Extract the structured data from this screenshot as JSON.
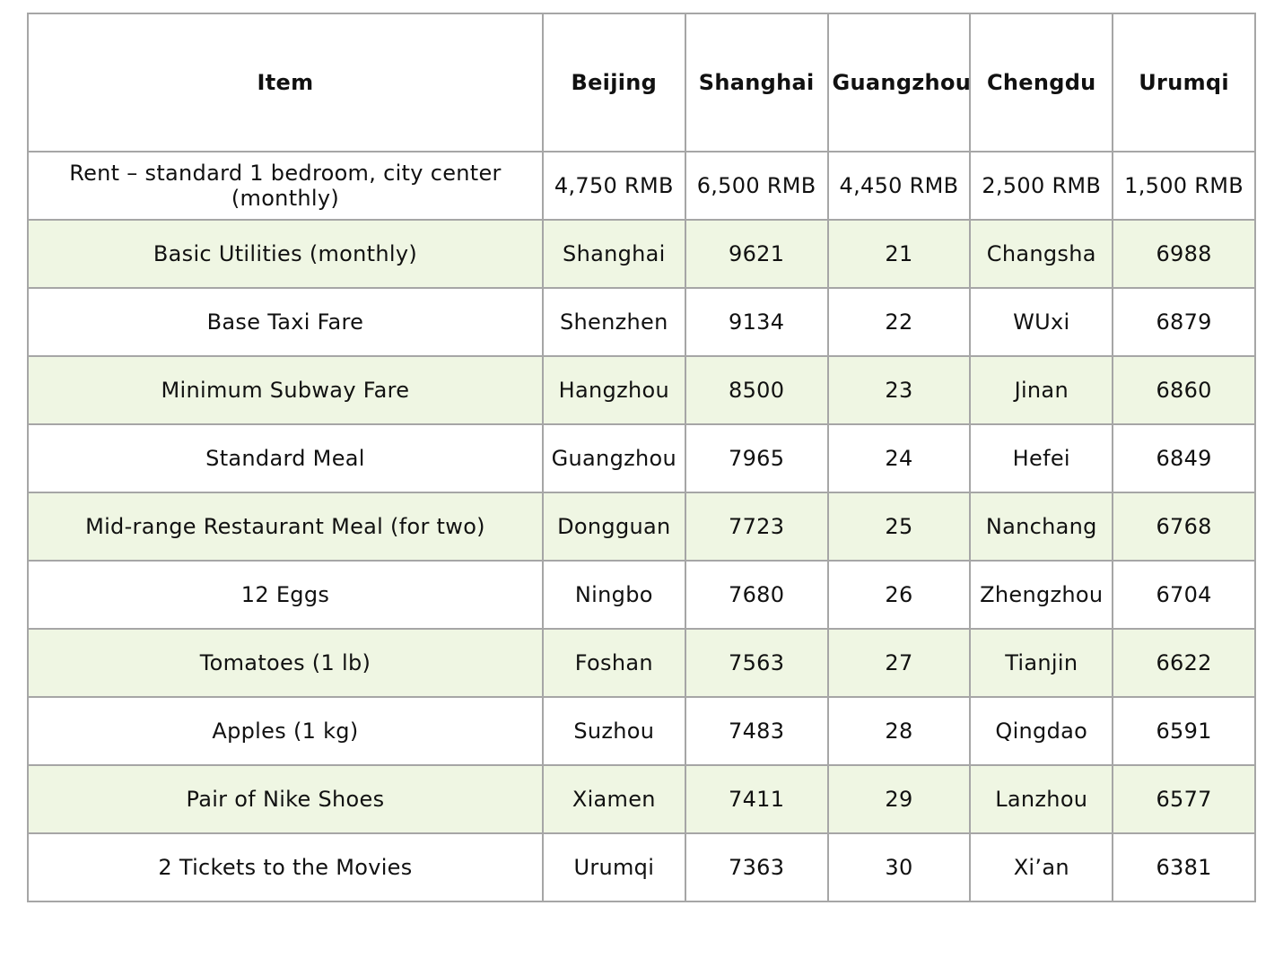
{
  "table": {
    "headers": [
      "Item",
      "Beijing",
      "Shanghai",
      "Guangzhou",
      "Chengdu",
      "Urumqi"
    ],
    "rows": [
      [
        "Rent – standard 1 bedroom, city center (monthly)",
        "4,750 RMB",
        "6,500 RMB",
        "4,450 RMB",
        "2,500 RMB",
        "1,500 RMB"
      ],
      [
        "Basic Utilities (monthly)",
        "Shanghai",
        "9621",
        "21",
        "Changsha",
        "6988"
      ],
      [
        "Base Taxi Fare",
        "Shenzhen",
        "9134",
        "22",
        "WUxi",
        "6879"
      ],
      [
        "Minimum Subway Fare",
        "Hangzhou",
        "8500",
        "23",
        "Jinan",
        "6860"
      ],
      [
        "Standard Meal",
        "Guangzhou",
        "7965",
        "24",
        "Hefei",
        "6849"
      ],
      [
        "Mid-range Restaurant Meal (for two)",
        "Dongguan",
        "7723",
        "25",
        "Nanchang",
        "6768"
      ],
      [
        "12 Eggs",
        "Ningbo",
        "7680",
        "26",
        "Zhengzhou",
        "6704"
      ],
      [
        "Tomatoes (1 lb)",
        "Foshan",
        "7563",
        "27",
        "Tianjin",
        "6622"
      ],
      [
        "Apples (1 kg)",
        "Suzhou",
        "7483",
        "28",
        "Qingdao",
        "6591"
      ],
      [
        "Pair of Nike Shoes",
        "Xiamen",
        "7411",
        "29",
        "Lanzhou",
        "6577"
      ],
      [
        "2 Tickets to the Movies",
        "Urumqi",
        "7363",
        "30",
        "Xi’an",
        "6381"
      ]
    ],
    "colors": {
      "border": "#a6a6a6",
      "shaded_row": "#eff6e3",
      "plain_row": "#ffffff"
    }
  }
}
